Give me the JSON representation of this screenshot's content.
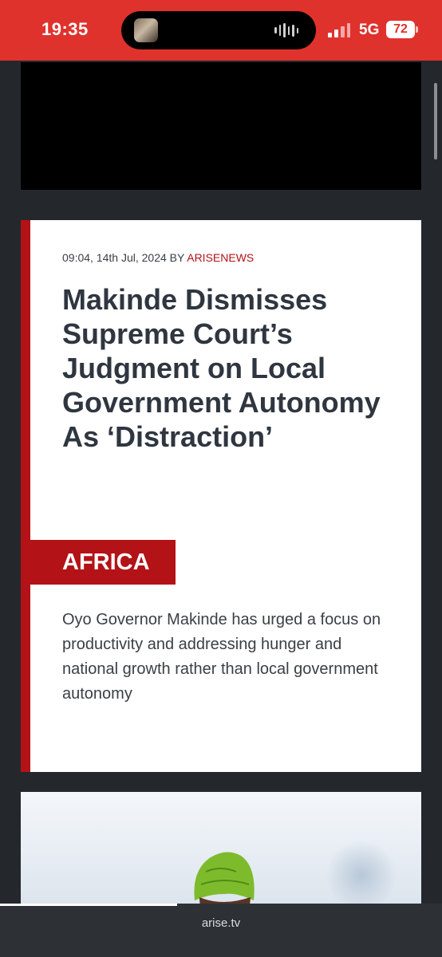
{
  "status_bar": {
    "time": "19:35",
    "network": "5G",
    "battery": "72",
    "background_color": "#e0322d"
  },
  "article": {
    "time": "09:04, 14th Jul, 2024",
    "by_label": "BY",
    "author": "ARISENEWS",
    "title": "Makinde Dismisses Supreme Court’s Judgment on Local Government Autonomy As ‘Distraction’",
    "category": "AFRICA",
    "summary": "Oyo Governor Makinde has urged a focus on productivity and addressing hunger and national growth rather than local government autonomy",
    "accent_color": "#b31217"
  },
  "browser": {
    "url": "arise.tv",
    "load_progress": 0.4
  }
}
